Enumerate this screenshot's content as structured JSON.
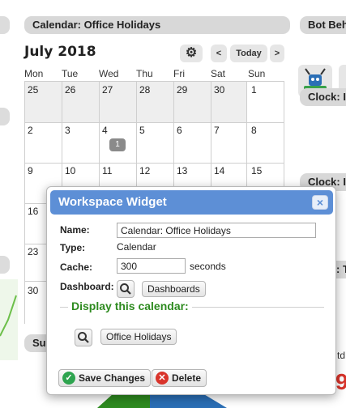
{
  "calendar": {
    "title": "Calendar: Office Holidays",
    "month": "July 2018",
    "today_label": "Today",
    "prev_label": "<",
    "next_label": ">",
    "weekdays": [
      "Mon",
      "Tue",
      "Wed",
      "Thu",
      "Fri",
      "Sat",
      "Sun"
    ],
    "weeks": [
      [
        "25",
        "26",
        "27",
        "28",
        "29",
        "30",
        "1"
      ],
      [
        "2",
        "3",
        "4",
        "5",
        "6",
        "7",
        "8"
      ],
      [
        "9",
        "10",
        "11",
        "12",
        "13",
        "14",
        "15"
      ],
      [
        "16"
      ],
      [
        "23"
      ],
      [
        "30"
      ]
    ],
    "event_badge": "1"
  },
  "right_column": {
    "bot_title": "Bot Beh",
    "clock1_title": "Clock: I",
    "clock2_title": "Clock: I",
    "partial_label": ": T",
    "partial_label2": "td",
    "partial_number": "9"
  },
  "left_column": {
    "partial_label": "Su"
  },
  "widget": {
    "title": "Workspace Widget",
    "close_label": "×",
    "name_label": "Name:",
    "name_value": "Calendar: Office Holidays",
    "type_label": "Type:",
    "type_value": "Calendar",
    "cache_label": "Cache:",
    "cache_value": "300",
    "cache_unit": "seconds",
    "dashboard_label": "Dashboard:",
    "dashboards_button": "Dashboards",
    "display_legend": "Display this calendar:",
    "calendar_button": "Office Holidays",
    "save_label": "Save Changes",
    "delete_label": "Delete"
  },
  "colors": {
    "titlebar": "#5d8fd6",
    "legend": "#2e8b20",
    "save_icon": "#2ea44f",
    "delete_icon": "#d9342b"
  }
}
